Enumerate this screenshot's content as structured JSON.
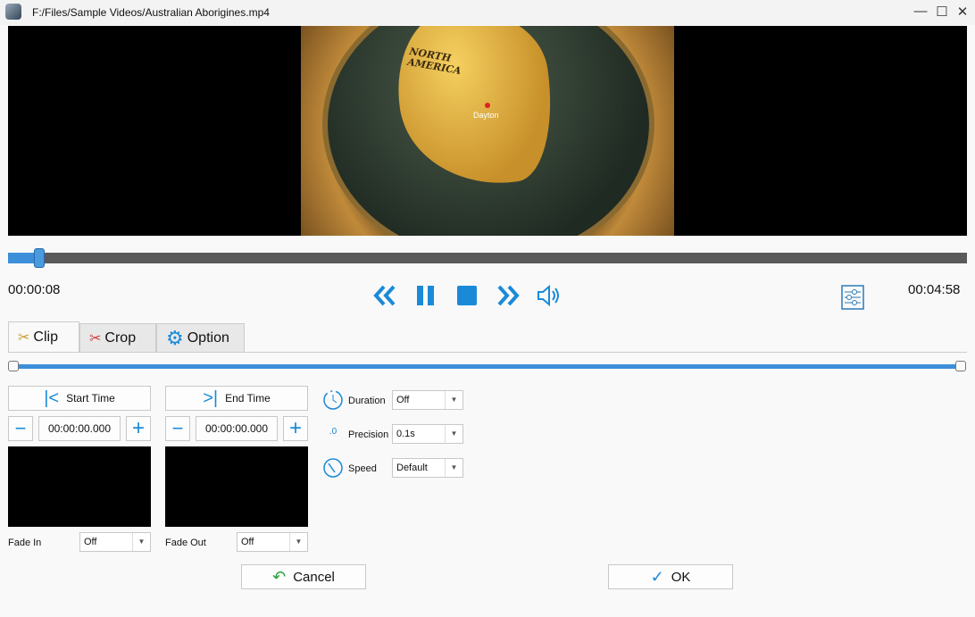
{
  "window": {
    "title": "F:/Files/Sample Videos/Australian Aborigines.mp4",
    "minimize": "—",
    "maximize": "☐",
    "close": "✕"
  },
  "video": {
    "overlay_label_1": "NORTH",
    "overlay_label_2": "AMERICA",
    "overlay_city": "Dayton"
  },
  "player": {
    "current_time": "00:00:08",
    "total_time": "00:04:58",
    "progress_percent": 3.3,
    "accent": "#1a8ad8"
  },
  "tabs": [
    {
      "label": "Clip",
      "active": true
    },
    {
      "label": "Crop"
    },
    {
      "label": "Option"
    }
  ],
  "clip": {
    "start_button": "Start Time",
    "end_button": "End Time",
    "start_value": "00:00:00.000",
    "end_value": "00:00:00.000",
    "minus": "−",
    "plus": "+",
    "fade_in_label": "Fade In",
    "fade_in_value": "Off",
    "fade_out_label": "Fade Out",
    "fade_out_value": "Off",
    "range_start_percent": 0,
    "range_end_percent": 100
  },
  "settings": {
    "duration_label": "Duration",
    "duration_value": "Off",
    "precision_label": "Precision",
    "precision_value": "0.1s",
    "speed_label": "Speed",
    "speed_value": "Default"
  },
  "footer": {
    "cancel": "Cancel",
    "ok": "OK"
  }
}
